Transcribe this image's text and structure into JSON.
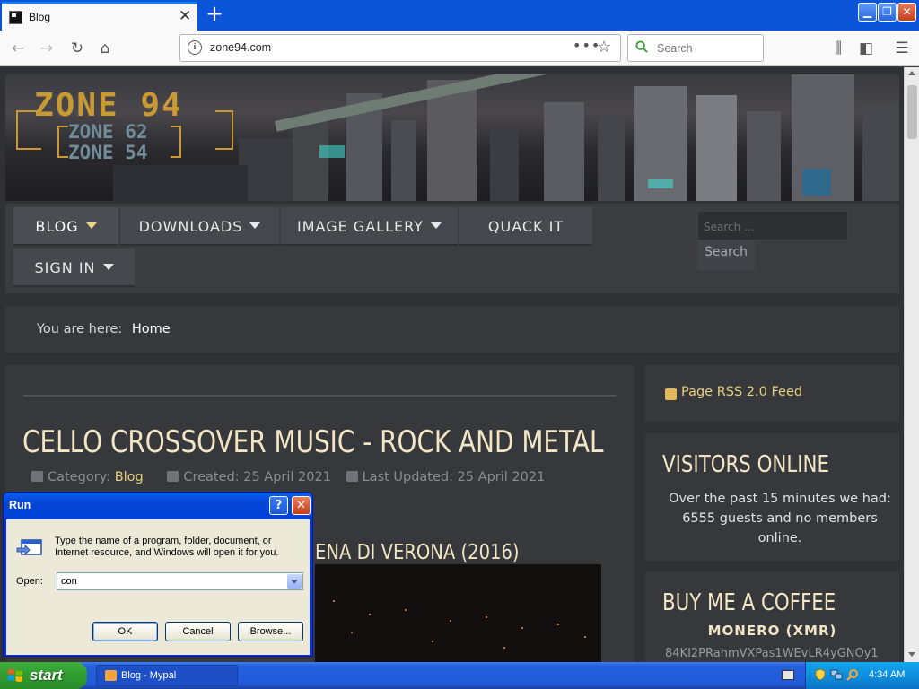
{
  "browser": {
    "tab_title": "Blog",
    "new_tab": "+",
    "url": "zone94.com",
    "search_placeholder": "Search",
    "page_actions": "•••"
  },
  "site": {
    "logo_main": "ZONE 94",
    "logo_sub1": "ZONE 62",
    "logo_sub2": "ZONE 54",
    "nav": [
      {
        "label": "BLOG"
      },
      {
        "label": "DOWNLOADS"
      },
      {
        "label": "IMAGE GALLERY"
      },
      {
        "label": "QUACK IT"
      },
      {
        "label": "SIGN IN"
      }
    ],
    "search_placeholder": "Search ...",
    "search_button": "Search",
    "breadcrumb_prefix": "You are here:",
    "breadcrumb_current": "Home"
  },
  "article": {
    "title": "CELLO CROSSOVER MUSIC - ROCK AND METAL",
    "category_label": "Category:",
    "category": "Blog",
    "created": "Created: 25 April 2021",
    "updated": "Last Updated: 25 April 2021",
    "subheading": "ENA DI VERONA (2016)"
  },
  "sidebar": {
    "rss": "Page RSS 2.0 Feed",
    "visitors_title": "VISITORS ONLINE",
    "visitors_text": "Over the past 15 minutes we had: 6555 guests and no members online.",
    "coffee_title": "BUY ME A COFFEE",
    "coffee_sub": "MONERO (XMR)",
    "coffee_addr": "84KI2PRahmVXPas1WEvLR4yGNOy1"
  },
  "run_dialog": {
    "title": "Run",
    "help": "?",
    "close": "✕",
    "description": "Type the name of a program, folder, document, or Internet resource, and Windows will open it for you.",
    "open_label": "Open:",
    "open_value": "con",
    "ok": "OK",
    "cancel": "Cancel",
    "browse": "Browse..."
  },
  "taskbar": {
    "start": "start",
    "task": "Blog - Mypal",
    "clock": "4:34 AM"
  }
}
